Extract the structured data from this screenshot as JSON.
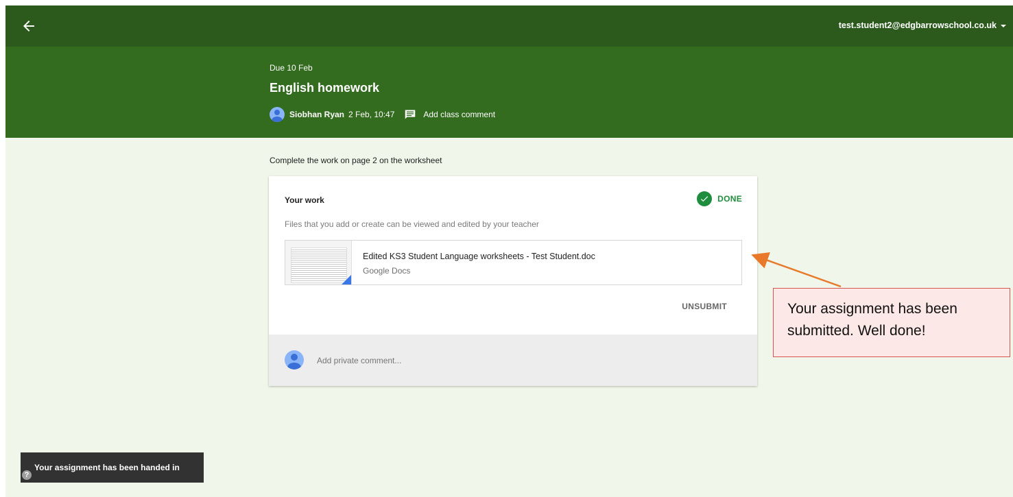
{
  "topbar": {
    "account_email": "test.student2@edgbarrowschool.co.uk",
    "back_icon": "arrow-left-icon"
  },
  "assignment": {
    "due": "Due 10 Feb",
    "title": "English homework",
    "teacher": "Siobhan Ryan",
    "posted": "2 Feb, 10:47",
    "add_class_comment": "Add class comment",
    "instructions": "Complete the work on page 2 on the worksheet"
  },
  "work": {
    "heading": "Your work",
    "status": "DONE",
    "files_note": "Files that you add or create can be viewed and edited by your teacher",
    "attachment": {
      "title": "Edited KS3 Student Language worksheets - Test Student.doc",
      "source": "Google Docs"
    },
    "unsubmit_label": "UNSUBMIT",
    "private_comment_placeholder": "Add private comment..."
  },
  "callout": {
    "text": "Your assignment has been submitted.  Well done!"
  },
  "snackbar": {
    "text": "Your assignment has been handed in",
    "help": "?"
  },
  "colors": {
    "topbar": "#2c5a1d",
    "header": "#336b1f",
    "background": "#f0f6e9",
    "done_green": "#1e8e3e",
    "callout_border": "#d9534f",
    "arrow": "#e8792a"
  }
}
